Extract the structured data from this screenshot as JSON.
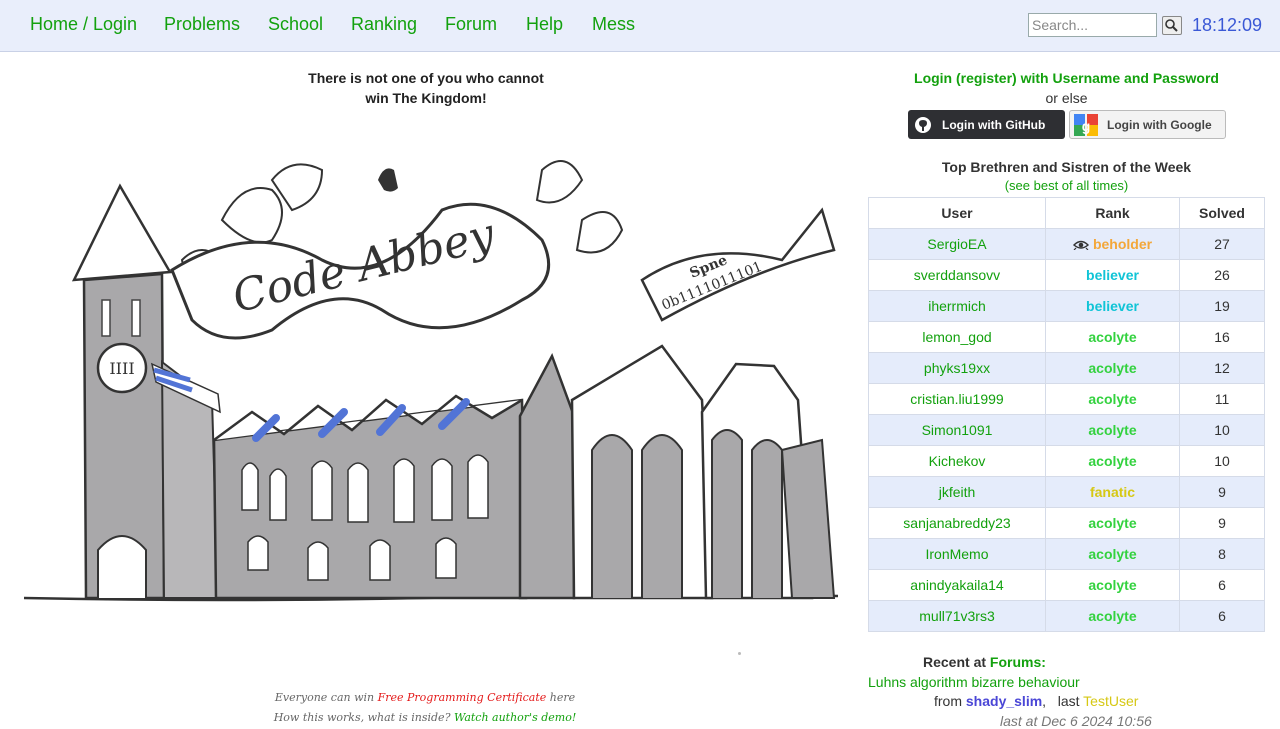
{
  "nav": {
    "items": [
      {
        "label": "Home / Login"
      },
      {
        "label": "Problems"
      },
      {
        "label": "School"
      },
      {
        "label": "Ranking"
      },
      {
        "label": "Forum"
      },
      {
        "label": "Help"
      },
      {
        "label": "Mess"
      }
    ],
    "search_placeholder": "Search...",
    "clock": "18:12:09"
  },
  "main": {
    "slogan_line1": "There is not one of you who cannot",
    "slogan_line2": "win The Kingdom!",
    "logo_text": "Code Abbey",
    "logo_banner_text": "Spne",
    "logo_banner_binary": "0b1111011101",
    "promo": {
      "line1_pre": "Everyone can win ",
      "line1_link": "Free Programming Certificate",
      "line1_post": " here",
      "line2_pre": "How this works, what is inside? ",
      "line2_link": "Watch author's demo!"
    }
  },
  "sidebar": {
    "login_title": "Login (register) with Username and Password",
    "or_else": "or else",
    "github_label": "Login with GitHub",
    "google_label": "Login with Google",
    "top_title": "Top Brethren and Sistren of the Week",
    "top_link": "(see best of all times)",
    "columns": [
      "User",
      "Rank",
      "Solved"
    ],
    "rows": [
      {
        "user": "SergioEA",
        "rank": "beholder",
        "solved": "27",
        "rank_icon": "eye-icon"
      },
      {
        "user": "sverddansovv",
        "rank": "believer",
        "solved": "26"
      },
      {
        "user": "iherrmich",
        "rank": "believer",
        "solved": "19"
      },
      {
        "user": "lemon_god",
        "rank": "acolyte",
        "solved": "16"
      },
      {
        "user": "phyks19xx",
        "rank": "acolyte",
        "solved": "12"
      },
      {
        "user": "cristian.liu1999",
        "rank": "acolyte",
        "solved": "11"
      },
      {
        "user": "Simon1091",
        "rank": "acolyte",
        "solved": "10"
      },
      {
        "user": "Kichekov",
        "rank": "acolyte",
        "solved": "10"
      },
      {
        "user": "jkfeith",
        "rank": "fanatic",
        "solved": "9"
      },
      {
        "user": "sanjanabreddy23",
        "rank": "acolyte",
        "solved": "9"
      },
      {
        "user": "IronMemo",
        "rank": "acolyte",
        "solved": "8"
      },
      {
        "user": "anindyakaila14",
        "rank": "acolyte",
        "solved": "6"
      },
      {
        "user": "mull71v3rs3",
        "rank": "acolyte",
        "solved": "6"
      }
    ],
    "recent": {
      "title_pre": "Recent at ",
      "title_link": "Forums:",
      "topic": "Luhns algorithm bizarre behaviour",
      "from_label": "from",
      "author": "shady_slim",
      "separator": ",",
      "last_label": "last",
      "last_user": "TestUser",
      "date": "last at Dec 6 2024 10:56"
    }
  },
  "colors": {
    "nav_link": "#13a10e",
    "clock": "#3a58d6",
    "beholder": "#f3a73a",
    "believer": "#10c4d6",
    "acolyte": "#33d23f",
    "fanatic": "#d6c814"
  }
}
